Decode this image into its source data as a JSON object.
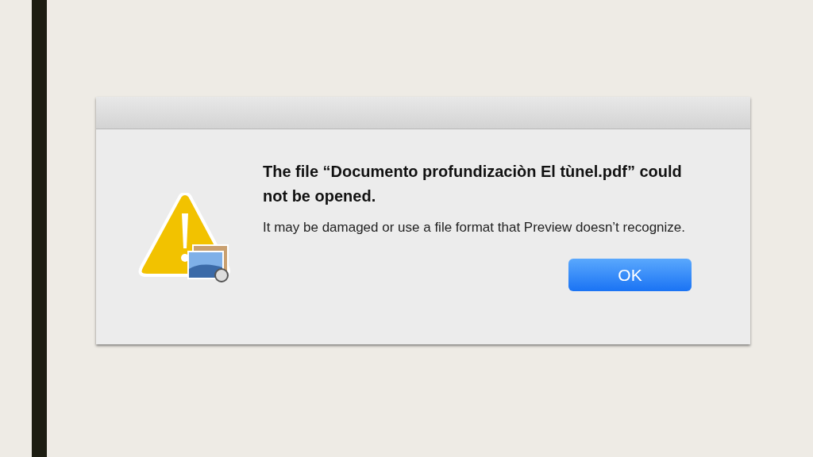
{
  "dialog": {
    "title": "The file “Documento profundizaciòn El tùnel.pdf” could not be opened.",
    "message": "It may be damaged or use a file format that Preview doesn’t recognize.",
    "buttons": [
      {
        "label": "OK",
        "kind": "default"
      }
    ]
  }
}
